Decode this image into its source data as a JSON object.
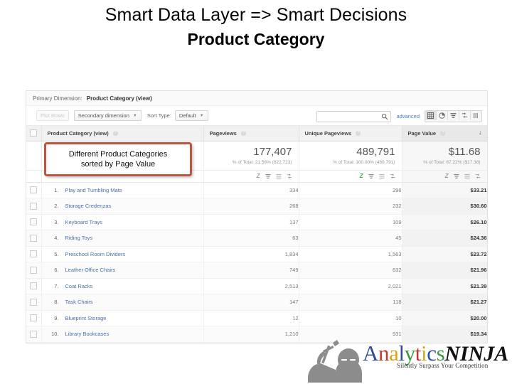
{
  "slide": {
    "title_line_1": "Smart Data Layer => Smart Decisions",
    "title_line_2": "Product Category"
  },
  "report": {
    "primary_dimension_label": "Primary Dimension:",
    "primary_dimension_value": "Product Category (view)",
    "controls": {
      "plot_rows_label": "Plot Rows",
      "secondary_dimension_label": "Secondary dimension",
      "sort_type_label": "Sort Type:",
      "sort_type_value": "Default",
      "search_value": "",
      "search_placeholder": "",
      "advanced_label": "advanced",
      "view_icons": [
        "table-view-icon",
        "pie-chart-view-icon",
        "performance-bar-view-icon",
        "comparison-view-icon",
        "pivot-view-icon"
      ]
    },
    "columns": [
      {
        "key": "dimension",
        "label": "Product Category (view)"
      },
      {
        "key": "pageviews",
        "label": "Pageviews"
      },
      {
        "key": "unique_pageviews",
        "label": "Unique Pageviews"
      },
      {
        "key": "page_value",
        "label": "Page Value"
      }
    ],
    "sorted_column": "Page Value",
    "sort_direction": "descending",
    "summary": {
      "pageviews": {
        "value": "177,407",
        "percent_of_total": "% of Total: 21.56% (822,723)"
      },
      "unique_pageviews": {
        "value": "489,791",
        "percent_of_total": "% of Total: 100.00% (489,791)"
      },
      "page_value": {
        "value": "$11.68",
        "percent_of_total": "% of Total: 67.22% ($17.38)"
      }
    },
    "rows": [
      {
        "num": "1.",
        "name": "Play and Tumbling Mats",
        "pageviews": "334",
        "unique_pageviews": "296",
        "page_value": "$33.21"
      },
      {
        "num": "2.",
        "name": "Storage Credenzas",
        "pageviews": "268",
        "unique_pageviews": "232",
        "page_value": "$30.60"
      },
      {
        "num": "3.",
        "name": "Keyboard Trays",
        "pageviews": "137",
        "unique_pageviews": "109",
        "page_value": "$26.10"
      },
      {
        "num": "4.",
        "name": "Riding Toys",
        "pageviews": "63",
        "unique_pageviews": "45",
        "page_value": "$24.36"
      },
      {
        "num": "5.",
        "name": "Preschool Room Dividers",
        "pageviews": "1,834",
        "unique_pageviews": "1,563",
        "page_value": "$23.72"
      },
      {
        "num": "6.",
        "name": "Leather Office Chairs",
        "pageviews": "749",
        "unique_pageviews": "632",
        "page_value": "$21.96"
      },
      {
        "num": "7.",
        "name": "Coat Racks",
        "pageviews": "2,513",
        "unique_pageviews": "2,021",
        "page_value": "$21.39"
      },
      {
        "num": "8.",
        "name": "Task Chairs",
        "pageviews": "147",
        "unique_pageviews": "118",
        "page_value": "$21.27"
      },
      {
        "num": "9.",
        "name": "Blueprint Storage",
        "pageviews": "12",
        "unique_pageviews": "10",
        "page_value": "$20.00"
      },
      {
        "num": "10.",
        "name": "Library Bookcases",
        "pageviews": "1,210",
        "unique_pageviews": "931",
        "page_value": "$19.34"
      }
    ]
  },
  "annotation": {
    "line_1": "Different Product Categories",
    "line_2": "sorted by Page Value",
    "border_color": "#c0533f"
  },
  "logo": {
    "word_letters": [
      {
        "ch": "A",
        "color": "#2b4a9b"
      },
      {
        "ch": "n",
        "color": "#c0392b"
      },
      {
        "ch": "a",
        "color": "#d9a420"
      },
      {
        "ch": "l",
        "color": "#2b4a9b"
      },
      {
        "ch": "y",
        "color": "#3a9a3a"
      },
      {
        "ch": "t",
        "color": "#c0392b"
      },
      {
        "ch": "i",
        "color": "#d9a420"
      },
      {
        "ch": "c",
        "color": "#2b4a9b"
      },
      {
        "ch": "s",
        "color": "#3a9a3a"
      }
    ],
    "ninja_text": "NINJA",
    "tagline": "Silently Surpass Your Competition"
  }
}
